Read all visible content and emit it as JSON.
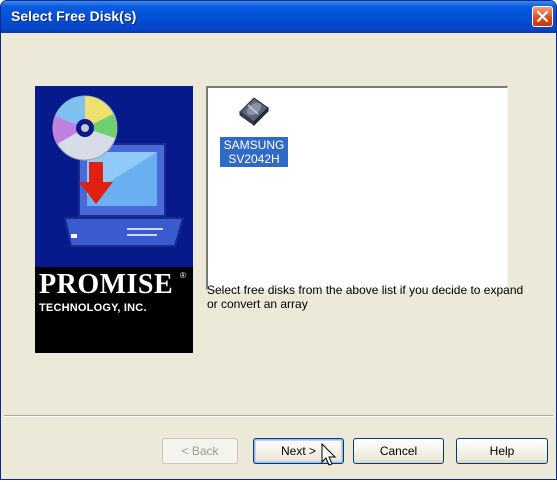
{
  "window": {
    "title": "Select Free Disk(s)"
  },
  "logo": {
    "brand": "PROMISE",
    "registered": "®",
    "company": "TECHNOLOGY, INC."
  },
  "disk_list": {
    "items": [
      {
        "label_line1": "SAMSUNG",
        "label_line2": "SV2042H",
        "selected": true
      }
    ]
  },
  "description": "Select free disks from the above list if you decide to expand or convert an array",
  "buttons": {
    "back": "< Back",
    "next": "Next >",
    "cancel": "Cancel",
    "help": "Help"
  },
  "colors": {
    "title_bar": "#0550d8",
    "selection": "#316ac5",
    "logo_bg": "#061a8c",
    "dialog_bg": "#ece9d8"
  }
}
